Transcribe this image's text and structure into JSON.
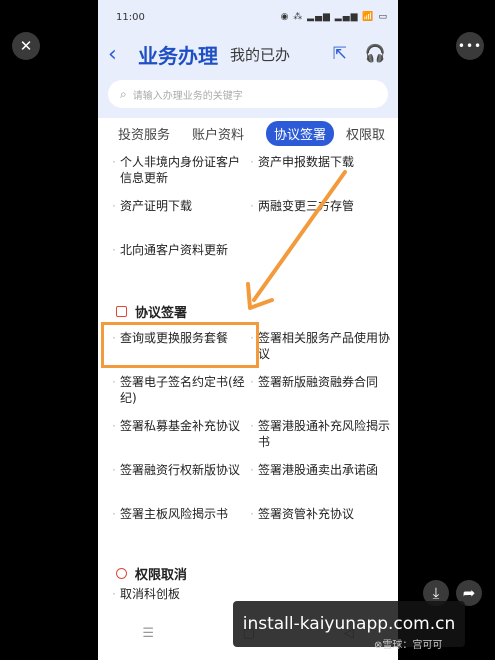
{
  "status": {
    "time": "11:00",
    "right": "◉ ⁂ ▂▄▆ ▂▄▆ 📶 ▭"
  },
  "header": {
    "title": "业务办理",
    "mine": "我的已办",
    "back": "‹",
    "share_icon": "⇱",
    "service_icon": "🎧"
  },
  "search": {
    "placeholder": "请输入办理业务的关键字"
  },
  "tabs": [
    "投资服务",
    "账户资料",
    "协议签署",
    "权限取"
  ],
  "grid1": [
    "个人非境内身份证客户信息更新",
    "资产申报数据下载",
    "资产证明下载",
    "两融变更三方存管",
    "北向通客户资料更新",
    ""
  ],
  "section_sign": "协议签署",
  "grid2": [
    "查询或更换服务套餐",
    "签署相关服务产品使用协议",
    "签署电子签名约定书(经纪)",
    "签署新版融资融券合同",
    "签署私募基金补充协议",
    "签署港股通补充风险揭示书",
    "签署融资行权新版协议",
    "签署港股通卖出承诺函",
    "签署主板风险揭示书",
    "签署资管补充协议"
  ],
  "section_cancel": "权限取消",
  "grid3": [
    "取消科创板",
    ""
  ],
  "overlay": {
    "close": "✕",
    "more": "•••",
    "save": "⤓",
    "share": "➦"
  },
  "watermark": "install-kaiyunapp.com.cn",
  "credit": "⊗雪球：宫可可",
  "colors": {
    "accent": "#2d5bd7",
    "highlight": "#f39a3d",
    "header_bg": "#e8eefb"
  }
}
